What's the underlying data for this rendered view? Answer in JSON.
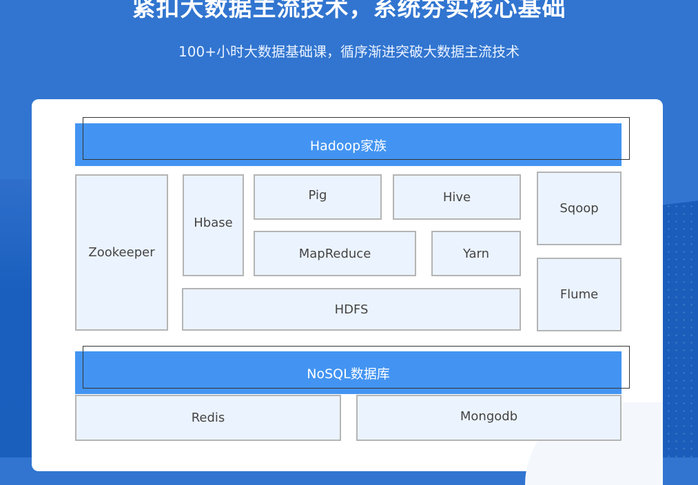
{
  "header": {
    "title": "紧扣大数据主流技术，系统夯实核心基础",
    "subtitle": "100+小时大数据基础课，循序渐进突破大数据主流技术"
  },
  "diagram": {
    "hadoop_section": {
      "label": "Hadoop家族",
      "components": {
        "zookeeper": "Zookeeper",
        "hbase": "Hbase",
        "pig": "Pig",
        "hive": "Hive",
        "mapreduce": "MapReduce",
        "yarn": "Yarn",
        "hdfs": "HDFS",
        "sqoop": "Sqoop",
        "flume": "Flume"
      }
    },
    "nosql_section": {
      "label": "NoSQL数据库",
      "components": {
        "redis": "Redis",
        "mongodb": "Mongodb"
      }
    }
  },
  "colors": {
    "background": "#3175d0",
    "section_bar": "#4394f2",
    "box_fill": "#ebf3fe",
    "box_border": "#b4b4b4",
    "accent_orange": "#f5a623"
  }
}
